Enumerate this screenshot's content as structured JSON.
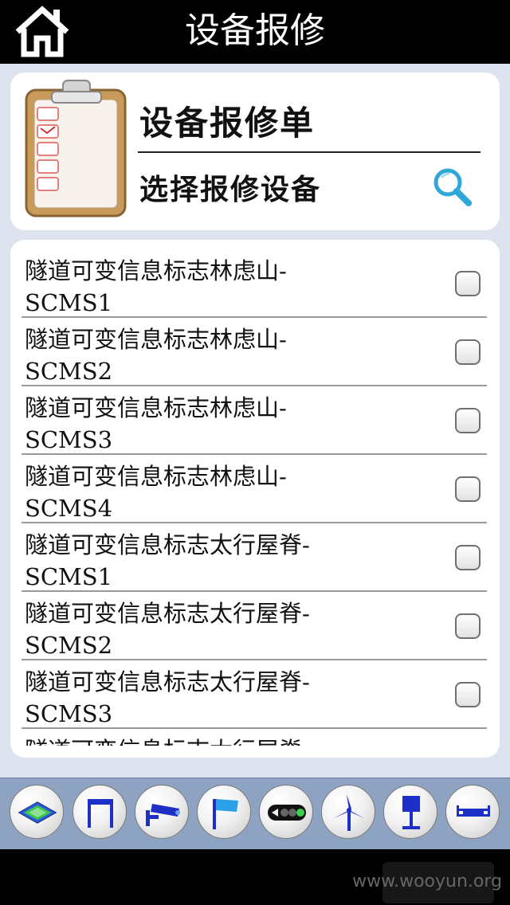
{
  "header": {
    "title": "设备报修"
  },
  "card": {
    "title": "设备报修单",
    "select_label": "选择报修设备"
  },
  "devices": [
    {
      "line1": "隧道可变信息标志林虑山-",
      "line2": "SCMS1"
    },
    {
      "line1": "隧道可变信息标志林虑山-",
      "line2": "SCMS2"
    },
    {
      "line1": "隧道可变信息标志林虑山-",
      "line2": "SCMS3"
    },
    {
      "line1": "隧道可变信息标志林虑山-",
      "line2": "SCMS4"
    },
    {
      "line1": "隧道可变信息标志太行屋脊-",
      "line2": "SCMS1"
    },
    {
      "line1": "隧道可变信息标志太行屋脊-",
      "line2": "SCMS2"
    },
    {
      "line1": "隧道可变信息标志太行屋脊-",
      "line2": "SCMS3"
    },
    {
      "line1": "隧道可变信息标志太行屋脊",
      "line2": ""
    }
  ],
  "toolbar": {
    "icons": [
      "layers-icon",
      "gantry-icon",
      "camera-icon",
      "flag-icon",
      "traffic-light-icon",
      "wind-turbine-icon",
      "sign-post-icon",
      "barrier-icon"
    ]
  },
  "watermark": "www.wooyun.org"
}
